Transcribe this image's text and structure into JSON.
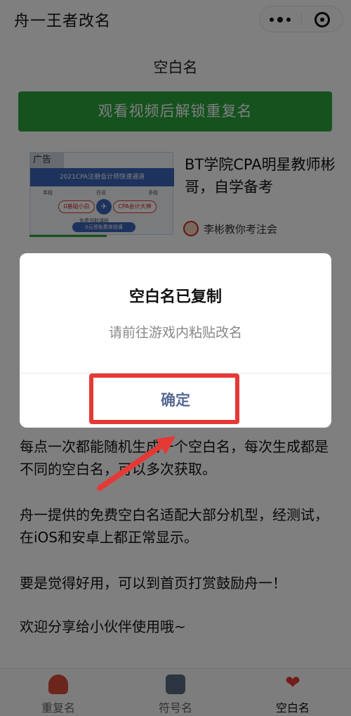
{
  "navbar": {
    "title": "舟一王者改名",
    "more_icon": "more-dots-icon",
    "close_icon": "target-icon"
  },
  "page": {
    "heading": "空白名",
    "unlock_button_label": "观看视频后解锁重复名"
  },
  "ad": {
    "tag": "广告",
    "banner_title": "2021CPA注册会计师快速通道",
    "tabs": [
      "单程",
      "往返",
      "多程"
    ],
    "from": "0基础小白",
    "to": "CPA会计大神",
    "sub": "免费领取课程",
    "cta": "0元领免费体验课",
    "headline": "BT学院CPA明星教师彬哥，自学备考",
    "author": "李彬教你考注会"
  },
  "body": {
    "p1": "每点一次都能随机生成一个空白名，每次生成都是不同的空白名，可以多次获取。",
    "p2": "舟一提供的免费空白名适配大部分机型，经测试，在iOS和安卓上都正常显示。",
    "p3": "要是觉得好用，可以到首页打赏鼓励舟一！",
    "p4": "欢迎分享给小伙伴使用哦~"
  },
  "tabbar": {
    "items": [
      {
        "label": "重复名",
        "icon": "duplicate-name-icon"
      },
      {
        "label": "符号名",
        "icon": "symbol-name-icon"
      },
      {
        "label": "空白名",
        "icon": "heart-icon",
        "active": true
      }
    ]
  },
  "modal": {
    "title": "空白名已复制",
    "message": "请前往游戏内粘贴改名",
    "confirm_label": "确定"
  },
  "colors": {
    "accent_green": "#2aa53c",
    "confirm_blue": "#576b95",
    "highlight_red": "#e53935"
  }
}
